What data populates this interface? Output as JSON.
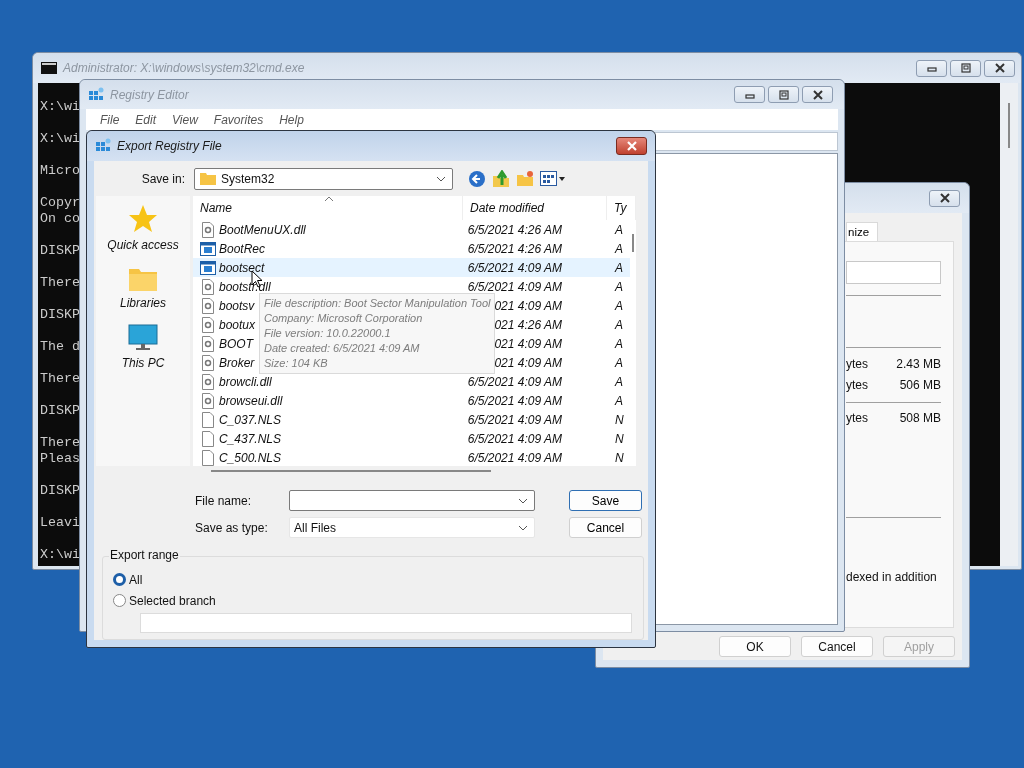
{
  "cmd_window": {
    "title": "Administrator: X:\\windows\\system32\\cmd.exe",
    "paragraphs": [
      [
        "X:\\wi"
      ],
      [
        "X:\\wi"
      ],
      [
        "Micro"
      ],
      [
        "Copyr",
        "On co"
      ],
      [
        "DISKP"
      ],
      [
        "There"
      ],
      [
        "DISKP"
      ],
      [
        "The d"
      ],
      [
        "There"
      ],
      [
        "DISKP"
      ],
      [
        "There",
        "Pleas"
      ],
      [
        "DISKP"
      ],
      [
        "Leavi"
      ],
      [
        "X:\\wi"
      ]
    ]
  },
  "properties_window": {
    "tab": "nize",
    "size_groups": [
      [
        {
          "label": "ytes",
          "value": "2.43 MB"
        },
        {
          "label": "ytes",
          "value": "506 MB"
        }
      ],
      [
        {
          "label": "ytes",
          "value": "508 MB"
        }
      ]
    ],
    "note": "dexed in addition",
    "buttons": [
      {
        "label": "OK",
        "disabled": false
      },
      {
        "label": "Cancel",
        "disabled": false
      },
      {
        "label": "Apply",
        "disabled": true
      }
    ]
  },
  "registry_editor": {
    "title": "Registry Editor",
    "menu": [
      "File",
      "Edit",
      "View",
      "Favorites",
      "Help"
    ]
  },
  "export_dialog": {
    "title": "Export Registry File",
    "save_in_label": "Save in:",
    "save_in_value": "System32",
    "places": [
      {
        "label": "Quick access",
        "kind": "star"
      },
      {
        "label": "Libraries",
        "kind": "folder"
      },
      {
        "label": "This PC",
        "kind": "monitor"
      }
    ],
    "columns": [
      "Name",
      "Date modified",
      "Ty"
    ],
    "files": [
      {
        "name": "BootMenuUX.dll",
        "date": "6/5/2021 4:26 AM",
        "type": "A",
        "kind": "dll",
        "hovered": false
      },
      {
        "name": "BootRec",
        "date": "6/5/2021 4:26 AM",
        "type": "A",
        "kind": "exe",
        "hovered": false
      },
      {
        "name": "bootsect",
        "date": "6/5/2021 4:09 AM",
        "type": "A",
        "kind": "exe",
        "hovered": true
      },
      {
        "name": "bootstr.dll",
        "date": "6/5/2021 4:09 AM",
        "type": "A",
        "kind": "dll",
        "hovered": false
      },
      {
        "name": "bootsv",
        "date": "021 4:09 AM",
        "type": "A",
        "kind": "dll",
        "hovered": false
      },
      {
        "name": "bootux",
        "date": "021 4:26 AM",
        "type": "A",
        "kind": "dll",
        "hovered": false
      },
      {
        "name": "BOOT",
        "date": "021 4:09 AM",
        "type": "A",
        "kind": "dll",
        "hovered": false
      },
      {
        "name": "Broker",
        "date": "021 4:09 AM",
        "type": "A",
        "kind": "dll",
        "hovered": false
      },
      {
        "name": "browcli.dll",
        "date": "6/5/2021 4:09 AM",
        "type": "A",
        "kind": "dll",
        "hovered": false
      },
      {
        "name": "browseui.dll",
        "date": "6/5/2021 4:09 AM",
        "type": "A",
        "kind": "dll",
        "hovered": false
      },
      {
        "name": "C_037.NLS",
        "date": "6/5/2021 4:09 AM",
        "type": "N",
        "kind": "nls",
        "hovered": false
      },
      {
        "name": "C_437.NLS",
        "date": "6/5/2021 4:09 AM",
        "type": "N",
        "kind": "nls",
        "hovered": false
      },
      {
        "name": "C_500.NLS",
        "date": "6/5/2021 4:09 AM",
        "type": "N",
        "kind": "nls",
        "hovered": false
      }
    ],
    "tooltip": [
      "File description: Boot Sector Manipulation Tool",
      "Company: Microsoft Corporation",
      "File version: 10.0.22000.1",
      "Date created: 6/5/2021 4:09 AM",
      "Size: 104 KB"
    ],
    "file_name_label": "File name:",
    "save_as_type_label": "Save as type:",
    "save_as_type_value": "All Files",
    "buttons": [
      "Save",
      "Cancel"
    ],
    "export_range": {
      "title": "Export range",
      "options": [
        {
          "label": "All",
          "selected": true
        },
        {
          "label": "Selected branch",
          "selected": false
        }
      ]
    }
  }
}
